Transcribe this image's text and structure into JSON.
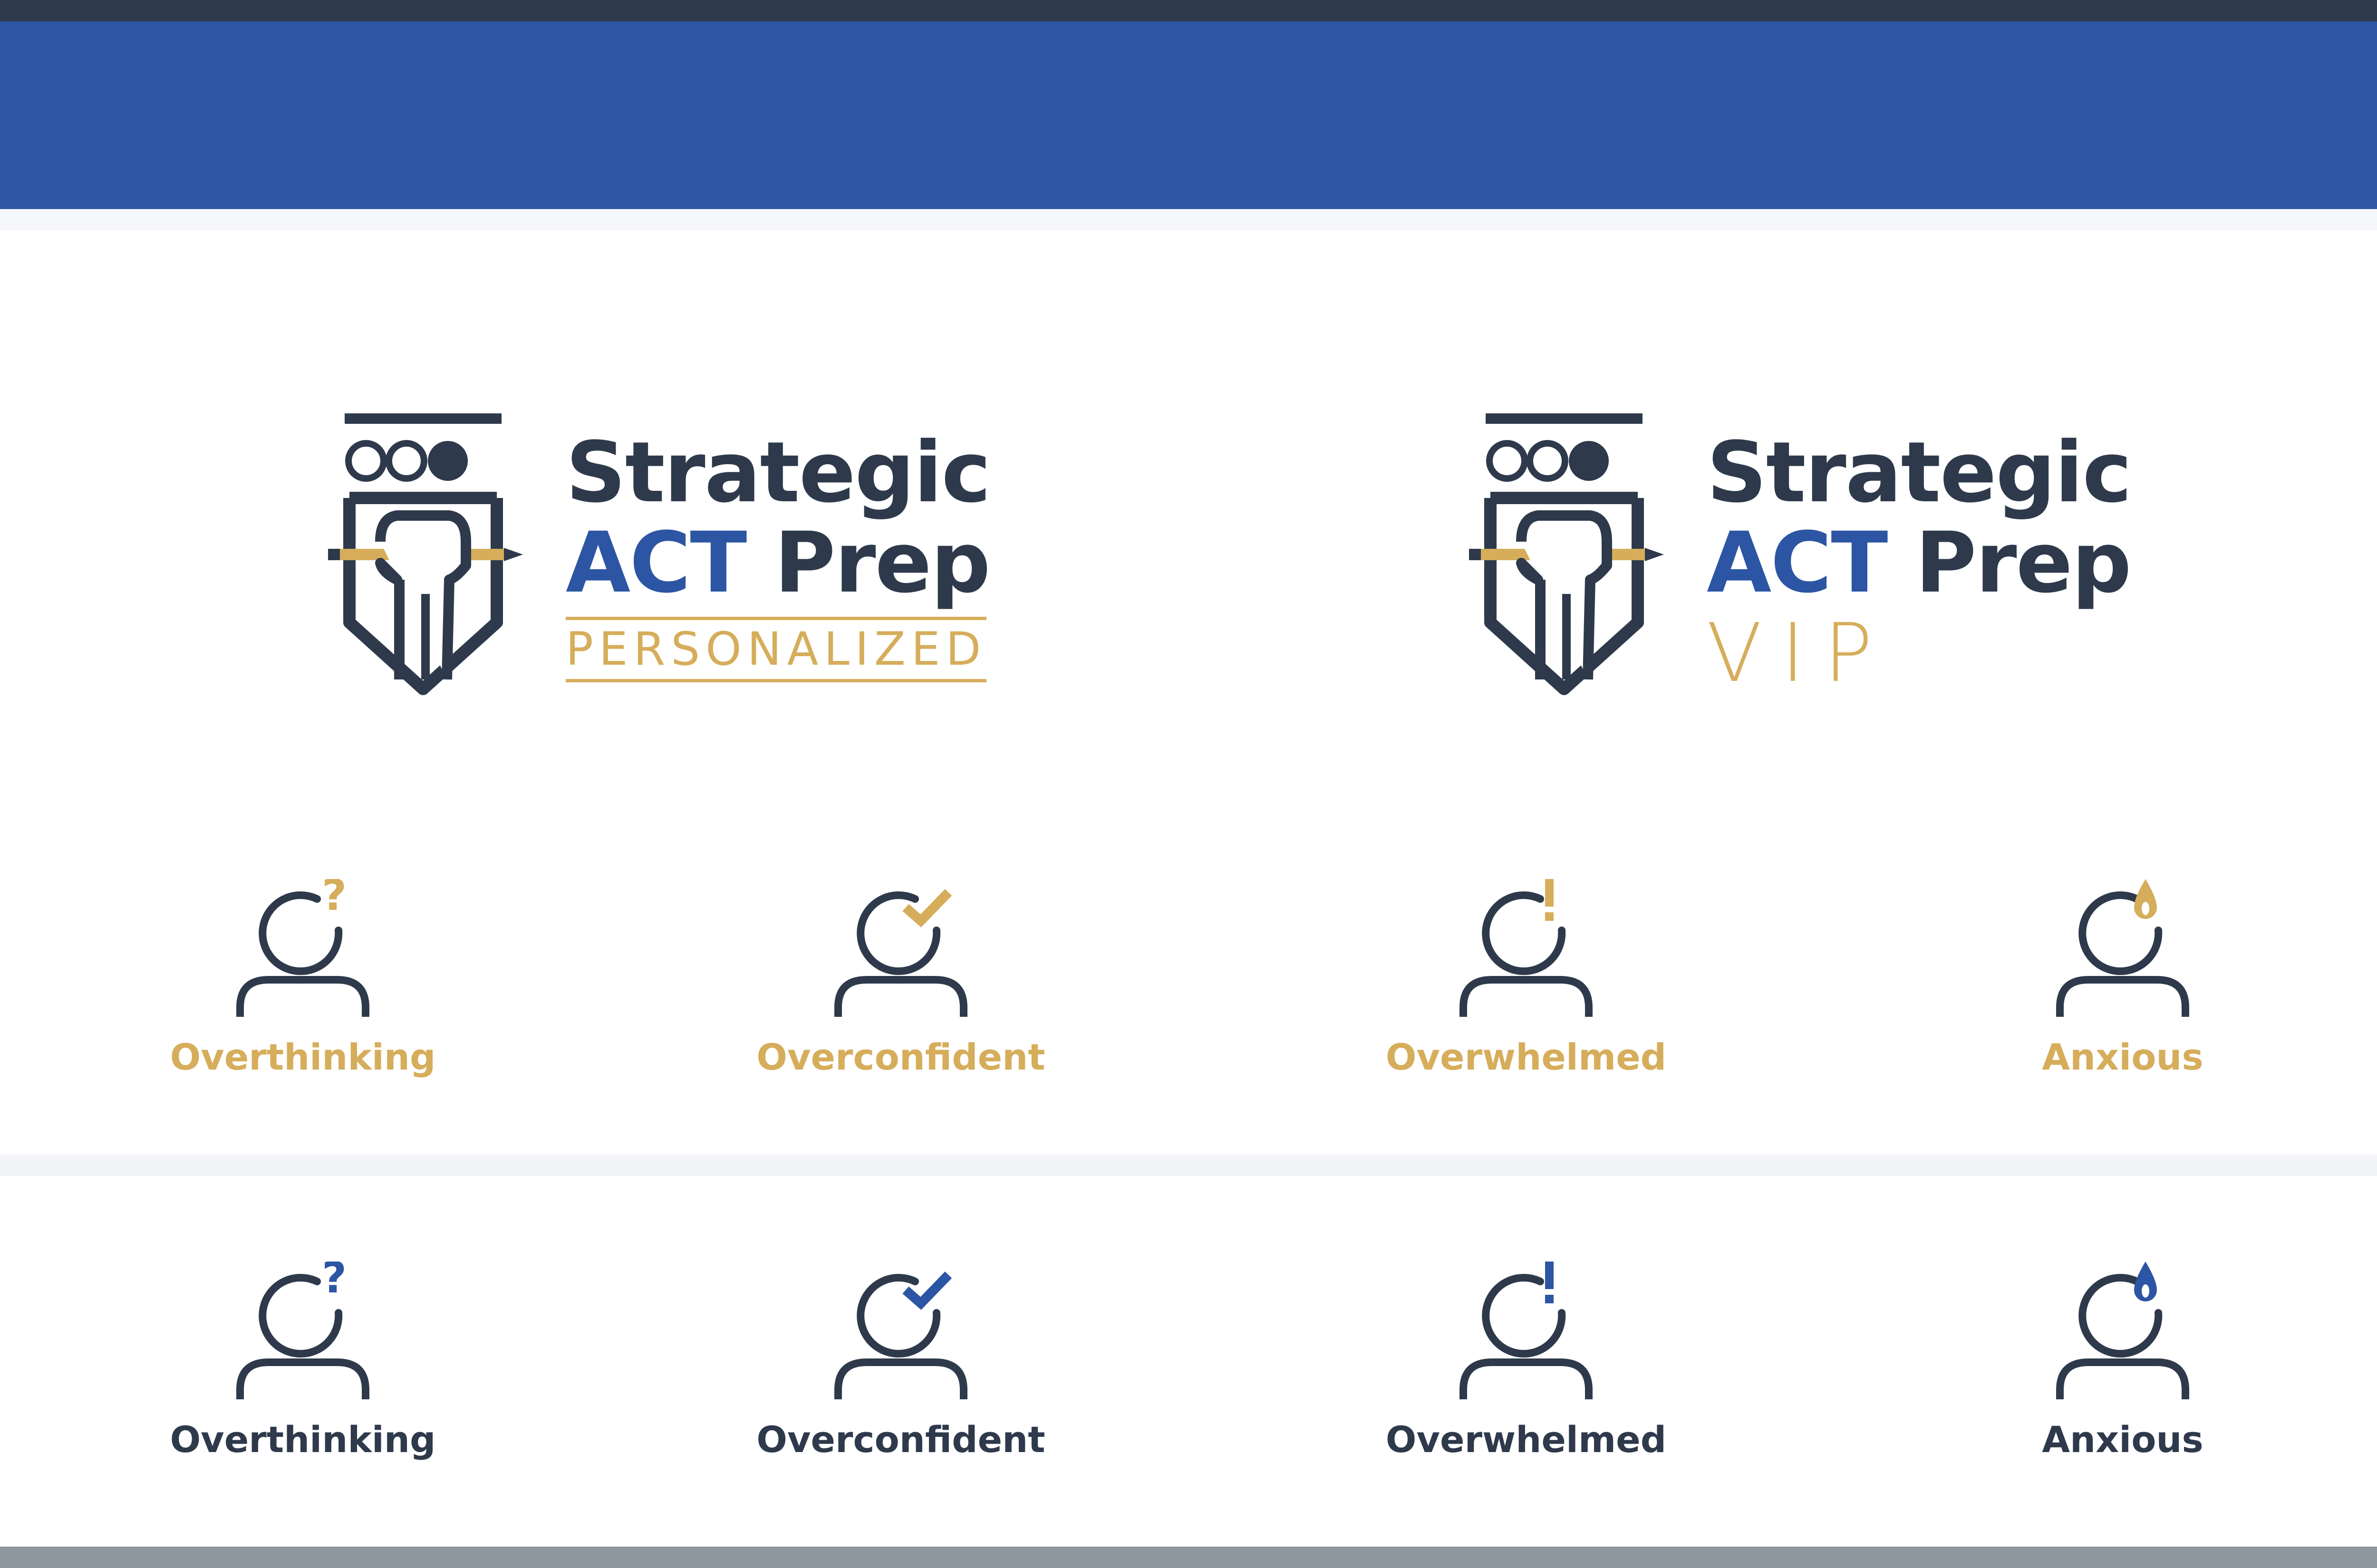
{
  "colors": {
    "navy": "#2e3a4b",
    "blue": "#2c55a3",
    "gold": "#d6ad5b",
    "bottom_bar": "#8e979d"
  },
  "logos": [
    {
      "line1": "Strategic",
      "act": "ACT",
      "prep": "Prep",
      "tagline": "PERSONALIZED"
    },
    {
      "line1": "Strategic",
      "act": "ACT",
      "prep": "Prep",
      "tagline": "VIP"
    }
  ],
  "icons_gold": [
    {
      "label": "Overthinking",
      "icon": "question-mark-icon"
    },
    {
      "label": "Overconfident",
      "icon": "checkmark-icon"
    },
    {
      "label": "Overwhelmed",
      "icon": "exclamation-icon"
    },
    {
      "label": "Anxious",
      "icon": "sweat-drop-icon"
    }
  ],
  "icons_dark": [
    {
      "label": "Overthinking",
      "icon": "question-mark-icon"
    },
    {
      "label": "Overconfident",
      "icon": "checkmark-icon"
    },
    {
      "label": "Overwhelmed",
      "icon": "exclamation-icon"
    },
    {
      "label": "Anxious",
      "icon": "sweat-drop-icon"
    }
  ]
}
